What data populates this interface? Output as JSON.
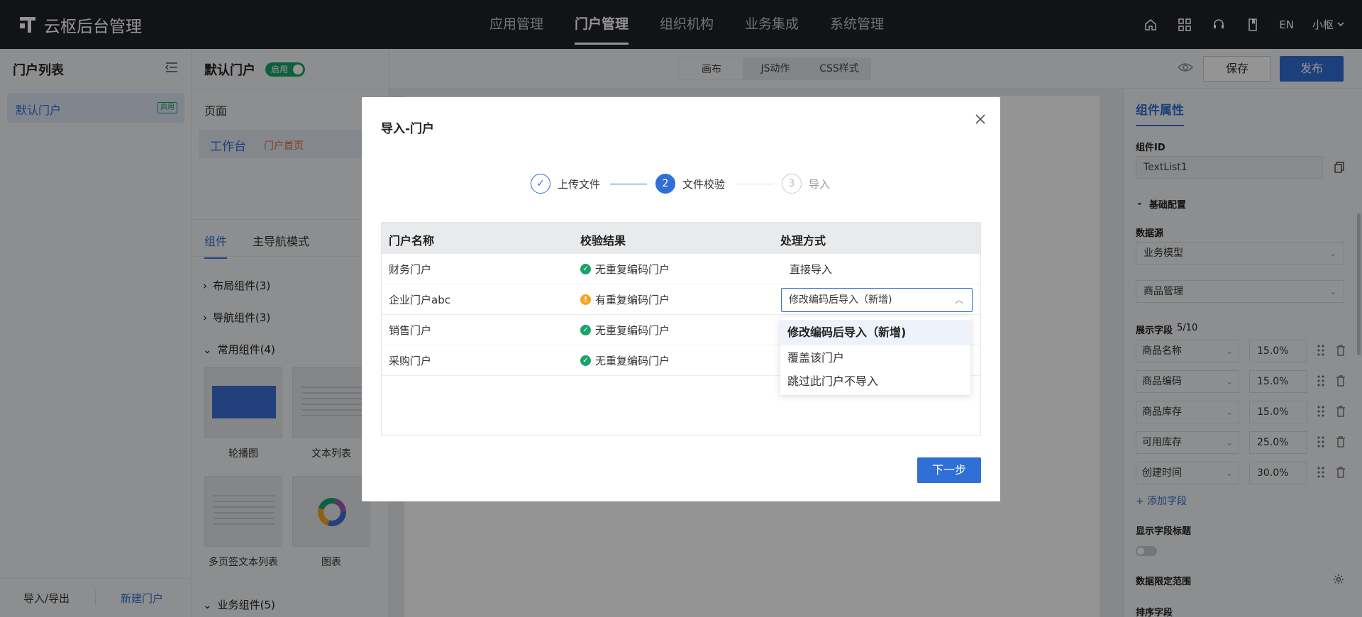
{
  "app": {
    "title": "云枢后台管理",
    "nav": [
      "应用管理",
      "门户管理",
      "组织机构",
      "业务集成",
      "系统管理"
    ],
    "nav_active": "门户管理",
    "lang": "EN",
    "user": "小枢"
  },
  "portal_list": {
    "title": "门户列表",
    "items": [
      {
        "name": "默认门户",
        "status": "启用"
      }
    ],
    "footer": {
      "import_export": "导入/导出",
      "new_portal": "新建门户"
    }
  },
  "editor": {
    "portal_name": "默认门户",
    "switch_label": "启用",
    "pages_label": "页面",
    "page": {
      "name": "工作台",
      "tag": "门户首页"
    },
    "tabs": [
      "组件",
      "主导航模式"
    ],
    "groups": [
      "布局组件(3)",
      "导航组件(3)",
      "常用组件(4)",
      "业务组件(5)"
    ],
    "cards": [
      "轮播图",
      "文本列表",
      "多页签文本列表",
      "图表"
    ]
  },
  "toolbar": {
    "modes": [
      "画布",
      "JS动作",
      "CSS样式"
    ],
    "active_mode": "画布",
    "save": "保存",
    "publish": "发布"
  },
  "props": {
    "title": "组件属性",
    "id_label": "组件ID",
    "id_value": "TextList1",
    "basic_config": "基础配置",
    "datasource_label": "数据源",
    "datasource_value": "业务模型",
    "model_value": "商品管理",
    "fields_label": "展示字段",
    "fields_count": "5/10",
    "fields": [
      {
        "name": "商品名称",
        "width": "15.0%"
      },
      {
        "name": "商品编码",
        "width": "15.0%"
      },
      {
        "name": "商品库存",
        "width": "15.0%"
      },
      {
        "name": "可用库存",
        "width": "25.0%"
      },
      {
        "name": "创建时间",
        "width": "30.0%"
      }
    ],
    "add_field": "+ 添加字段",
    "show_title_label": "显示字段标题",
    "data_scope_label": "数据限定范围",
    "sort_label": "排序字段"
  },
  "modal": {
    "title": "导入-门户",
    "steps": [
      {
        "num": "✓",
        "label": "上传文件",
        "state": "done"
      },
      {
        "num": "2",
        "label": "文件校验",
        "state": "active"
      },
      {
        "num": "3",
        "label": "导入",
        "state": "pending"
      }
    ],
    "columns": [
      "门户名称",
      "校验结果",
      "处理方式"
    ],
    "rows": [
      {
        "name": "财务门户",
        "result": "无重复编码门户",
        "status": "ok",
        "action": "直接导入"
      },
      {
        "name": "企业门户abc",
        "result": "有重复编码门户",
        "status": "warn",
        "action": "修改编码后导入（新增)"
      },
      {
        "name": "销售门户",
        "result": "无重复编码门户",
        "status": "ok",
        "action": ""
      },
      {
        "name": "采购门户",
        "result": "无重复编码门户",
        "status": "ok",
        "action": ""
      }
    ],
    "dropdown_options": [
      "修改编码后导入（新增)",
      "覆盖该门户",
      "跳过此门户不导入"
    ],
    "dropdown_selected": "修改编码后导入（新增)",
    "next": "下一步"
  }
}
